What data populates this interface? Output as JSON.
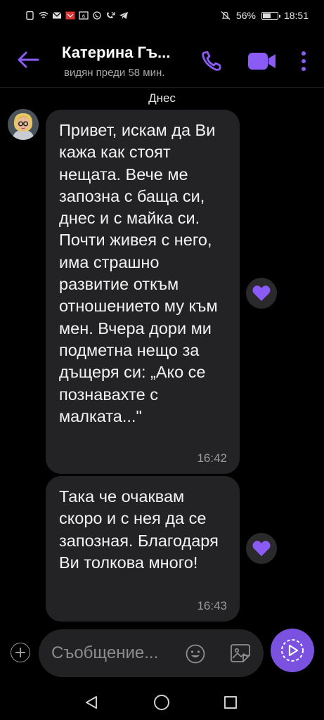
{
  "status_bar": {
    "battery_percent": "56%",
    "battery_level": 0.56,
    "time": "18:51"
  },
  "header": {
    "contact_name": "Катерина Гъ...",
    "last_seen": "видян преди 58 мин."
  },
  "chat": {
    "date_separator": "Днес",
    "messages": [
      {
        "text": "Привет, искам да Ви кажа как стоят нещата. Вече ме запозна с баща си, днес и с майка си. Почти живея с него, има страшно развитие откъм отношението му към мен. Вчера дори ми подметна нещо за дъщеря си: „Ако се познавахте с малката...\"",
        "time": "16:42",
        "reaction": "heart-icon"
      },
      {
        "text": "Така че очаквам скоро и с нея да се запозная. Благодаря Ви толкова много!",
        "time": "16:43",
        "reaction": "heart-icon"
      }
    ]
  },
  "composer": {
    "placeholder": "Съобщение..."
  },
  "colors": {
    "accent": "#7b52e0",
    "bubble": "#232325",
    "background": "#000000"
  }
}
